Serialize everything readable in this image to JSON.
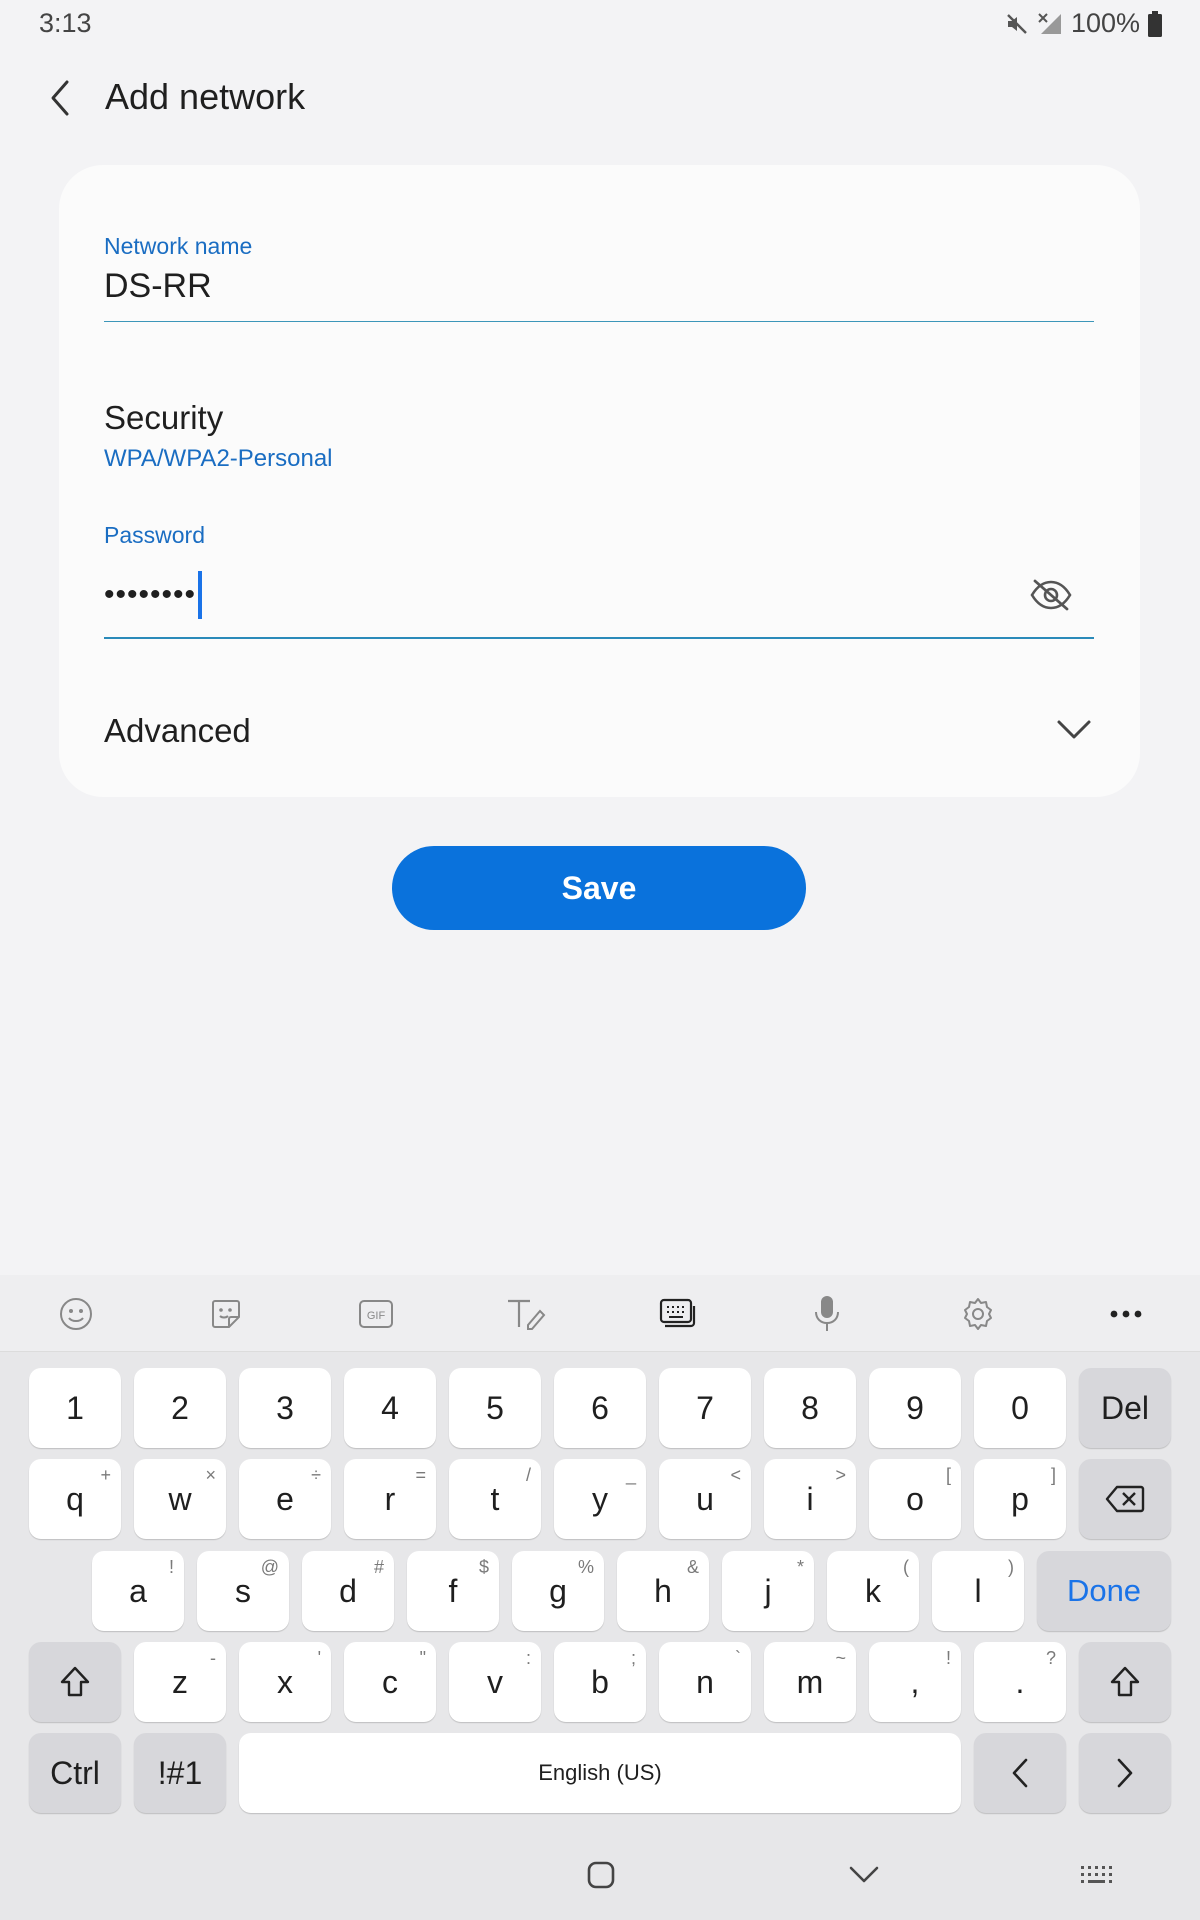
{
  "status_bar": {
    "time": "3:13",
    "battery": "100%"
  },
  "header": {
    "title": "Add network"
  },
  "form": {
    "network_name": {
      "label": "Network name",
      "value": "DS-RR"
    },
    "security": {
      "label": "Security",
      "value": "WPA/WPA2-Personal"
    },
    "password": {
      "label": "Password",
      "value": "••••••••"
    },
    "advanced": {
      "label": "Advanced"
    }
  },
  "save_label": "Save",
  "keyboard": {
    "row_numbers": [
      "1",
      "2",
      "3",
      "4",
      "5",
      "6",
      "7",
      "8",
      "9",
      "0"
    ],
    "del": "Del",
    "row_q": [
      {
        "k": "q",
        "s": "+"
      },
      {
        "k": "w",
        "s": "×"
      },
      {
        "k": "e",
        "s": "÷"
      },
      {
        "k": "r",
        "s": "="
      },
      {
        "k": "t",
        "s": "/"
      },
      {
        "k": "y",
        "s": "_"
      },
      {
        "k": "u",
        "s": "<"
      },
      {
        "k": "i",
        "s": ">"
      },
      {
        "k": "o",
        "s": "["
      },
      {
        "k": "p",
        "s": "]"
      }
    ],
    "row_a": [
      {
        "k": "a",
        "s": "!"
      },
      {
        "k": "s",
        "s": "@"
      },
      {
        "k": "d",
        "s": "#"
      },
      {
        "k": "f",
        "s": "$"
      },
      {
        "k": "g",
        "s": "%"
      },
      {
        "k": "h",
        "s": "&"
      },
      {
        "k": "j",
        "s": "*"
      },
      {
        "k": "k",
        "s": "("
      },
      {
        "k": "l",
        "s": ")"
      }
    ],
    "done": "Done",
    "row_z": [
      {
        "k": "z",
        "s": "-"
      },
      {
        "k": "x",
        "s": "'"
      },
      {
        "k": "c",
        "s": "\""
      },
      {
        "k": "v",
        "s": ":"
      },
      {
        "k": "b",
        "s": ";"
      },
      {
        "k": "n",
        "s": "`"
      },
      {
        "k": "m",
        "s": "~"
      },
      {
        "k": ",",
        "s": "!"
      },
      {
        "k": ".",
        "s": "?"
      }
    ],
    "ctrl": "Ctrl",
    "symbols": "!#1",
    "space": "English (US)"
  },
  "colors": {
    "accent": "#0a72dc",
    "link": "#1a6dc2",
    "background": "#f3f3f5"
  }
}
